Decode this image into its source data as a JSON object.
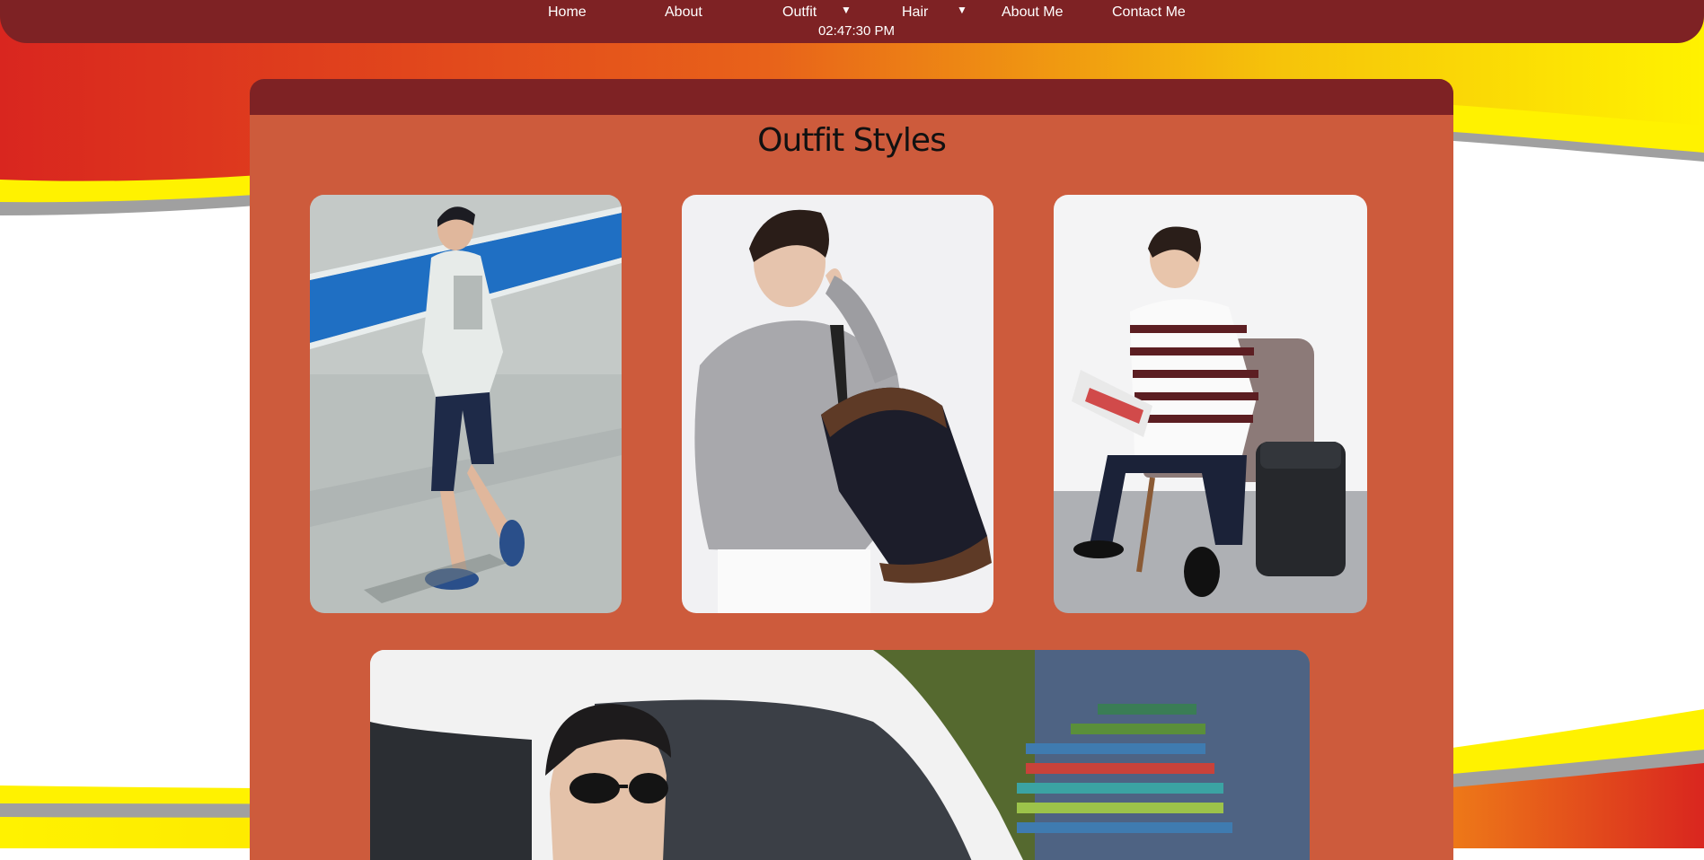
{
  "nav": {
    "items": [
      "Home",
      "About",
      "Outfit",
      "Hair",
      "About Me",
      "Contact Me"
    ],
    "dropdown_arrow": "▼",
    "clock": "02:47:30 PM"
  },
  "main": {
    "title": "Outfit Styles",
    "photos": [
      {
        "name": "photo-man-walking-white-jacket"
      },
      {
        "name": "photo-man-grey-sweater-backpack"
      },
      {
        "name": "photo-man-striped-sweater-chair"
      },
      {
        "name": "photo-man-sunglasses-van"
      }
    ]
  },
  "colors": {
    "nav_bg": "#7e2224",
    "panel_bg": "#cd5b3c",
    "swoosh_red": "#d9261f",
    "swoosh_yellow": "#fff200"
  }
}
